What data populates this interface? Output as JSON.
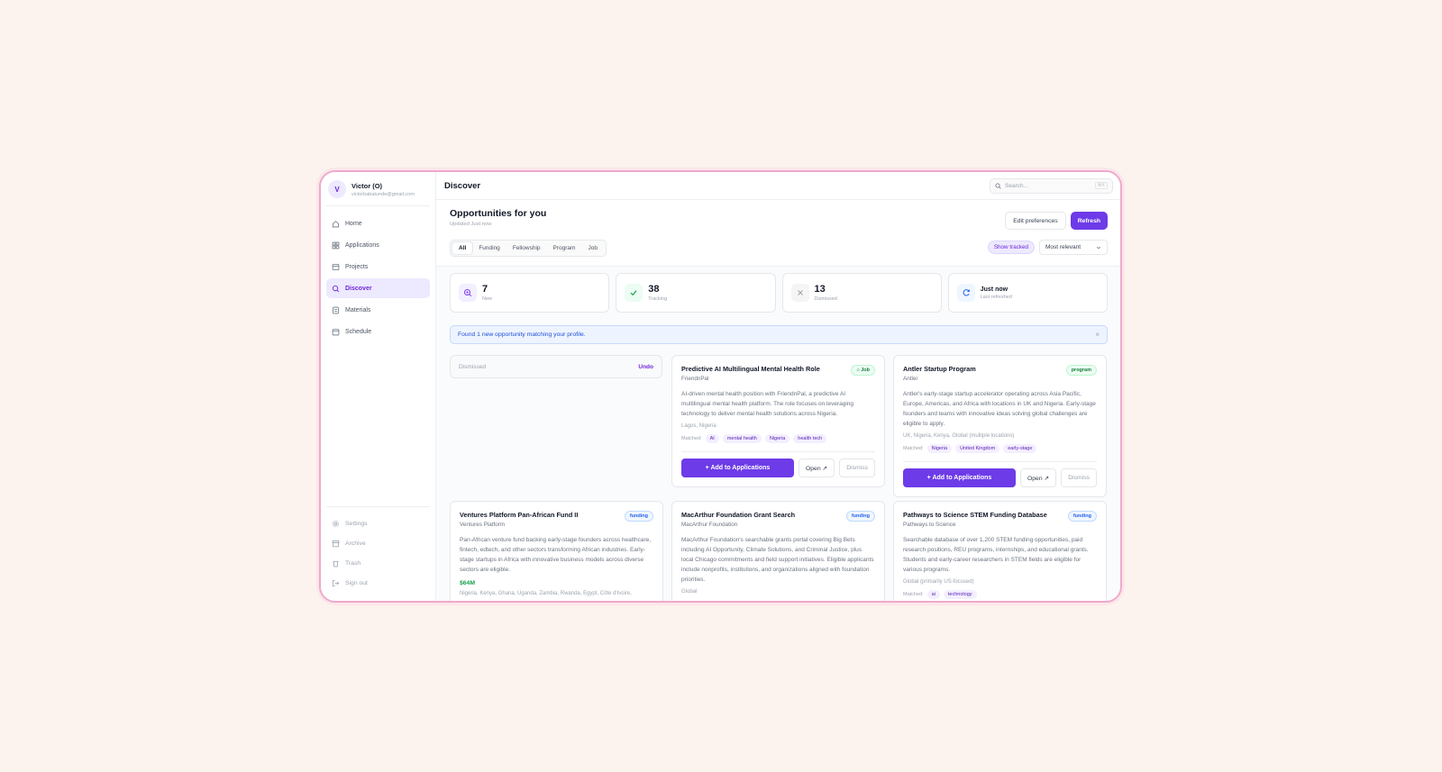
{
  "user": {
    "initial": "V",
    "name": "Victor (O)",
    "email": "victorbabatunde@gmail.com"
  },
  "sidebar": {
    "items": [
      {
        "label": "Home",
        "icon": "home-icon"
      },
      {
        "label": "Applications",
        "icon": "grid-icon"
      },
      {
        "label": "Projects",
        "icon": "folder-icon"
      },
      {
        "label": "Discover",
        "icon": "search-icon",
        "active": true
      },
      {
        "label": "Materials",
        "icon": "document-icon"
      },
      {
        "label": "Schedule",
        "icon": "calendar-icon"
      }
    ],
    "bottom": [
      {
        "label": "Settings",
        "icon": "gear-icon"
      },
      {
        "label": "Archive",
        "icon": "archive-icon"
      },
      {
        "label": "Trash",
        "icon": "trash-icon"
      },
      {
        "label": "Sign out",
        "icon": "sign-out-icon"
      }
    ]
  },
  "topbar": {
    "title": "Discover",
    "search_placeholder": "Search...",
    "shortcut": "⌘K"
  },
  "header": {
    "title": "Opportunities for you",
    "updated": "Updated Just now",
    "edit_label": "Edit preferences",
    "refresh_label": "Refresh",
    "filters": [
      "All",
      "Funding",
      "Fellowship",
      "Program",
      "Job"
    ],
    "show_tracked": "Show tracked",
    "sort": "Most relevant"
  },
  "stats": [
    {
      "value": "7",
      "label": "New"
    },
    {
      "value": "38",
      "label": "Tracking"
    },
    {
      "value": "13",
      "label": "Dismissed"
    },
    {
      "value": "Just now",
      "label": "Last refreshed"
    }
  ],
  "banner": {
    "text": "Found 1 new opportunity matching your profile.",
    "close": "×"
  },
  "dismissed": {
    "text": "Dismissed",
    "undo": "Undo"
  },
  "cards": [
    {
      "title": "Predictive AI Multilingual Mental Health Role",
      "org": "FriendnPal",
      "badge": "Job",
      "desc": "AI-driven mental health position with FriendnPal, a predictive AI multilingual mental health platform. The role focuses on leveraging technology to deliver mental health solutions across Nigeria.",
      "location": "Lagos, Nigeria",
      "matched_label": "Matched:",
      "tags": [
        "AI",
        "mental health",
        "Nigeria",
        "health tech"
      ],
      "add": "+ Add to Applications",
      "open": "Open ↗",
      "dismiss": "Dismiss"
    },
    {
      "title": "Antler Startup Program",
      "org": "Antler",
      "badge": "program",
      "desc": "Antler's early-stage startup accelerator operating across Asia Pacific, Europe, Americas, and Africa with locations in UK and Nigeria. Early-stage founders and teams with innovative ideas solving global challenges are eligible to apply.",
      "location": "UK, Nigeria, Kenya, Global (multiple locations)",
      "matched_label": "Matched:",
      "tags": [
        "Nigeria",
        "United Kingdom",
        "early-stage"
      ],
      "add": "+ Add to Applications",
      "open": "Open ↗",
      "dismiss": "Dismiss"
    },
    {
      "title": "Ventures Platform Pan-African Fund II",
      "org": "Ventures Platform",
      "badge": "funding",
      "desc": "Pan-African venture fund backing early-stage founders across healthcare, fintech, edtech, and other sectors transforming African industries. Early-stage startups in Africa with innovative business models across diverse sectors are eligible.",
      "amount": "$64M",
      "location": "Nigeria, Kenya, Ghana, Uganda, Zambia, Rwanda, Egypt, Côte d'Ivoire,"
    },
    {
      "title": "MacArthur Foundation Grant Search",
      "org": "MacArthur Foundation",
      "badge": "funding",
      "desc": "MacArthur Foundation's searchable grants portal covering Big Bets including AI Opportunity, Climate Solutions, and Criminal Justice, plus local Chicago commitments and field support initiatives. Eligible applicants include nonprofits, institutions, and organizations aligned with foundation priorities.",
      "location": "Global"
    },
    {
      "title": "Pathways to Science STEM Funding Database",
      "org": "Pathways to Science",
      "badge": "funding",
      "desc": "Searchable database of over 1,200 STEM funding opportunities, paid research positions, REU programs, internships, and educational grants. Students and early-career researchers in STEM fields are eligible for various programs.",
      "location": "Global (primarily US-focused)",
      "matched_label": "Matched:",
      "tags": [
        "ai",
        "technology"
      ]
    }
  ]
}
